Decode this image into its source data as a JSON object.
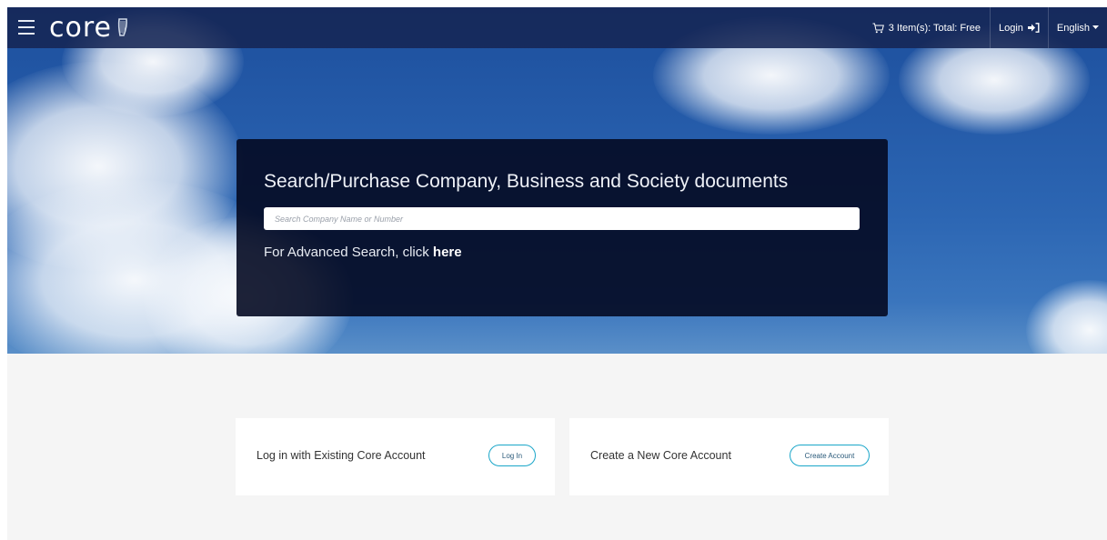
{
  "header": {
    "logo_text": "core",
    "cart_text": "3 Item(s): Total: Free",
    "login_label": "Login",
    "language_label": "English"
  },
  "icons": {
    "menu": "hamburger-menu-icon",
    "logo": "harp-icon",
    "cart": "cart-icon",
    "login": "sign-in-icon",
    "language": "caret-down-icon"
  },
  "hero": {
    "title": "Search/Purchase Company, Business and Society documents",
    "search_placeholder": "Search Company Name or Number",
    "advanced_prefix": "For Advanced Search, click ",
    "advanced_link": "here"
  },
  "cards": {
    "login": {
      "label": "Log in with Existing Core Account",
      "button": "Log In"
    },
    "create": {
      "label": "Create a New Core Account",
      "button": "Create Account"
    }
  },
  "colors": {
    "navbar": "#162654",
    "panel": "#040a22",
    "button_border": "#1aa6c9",
    "lower_background": "#f5f5f5"
  }
}
